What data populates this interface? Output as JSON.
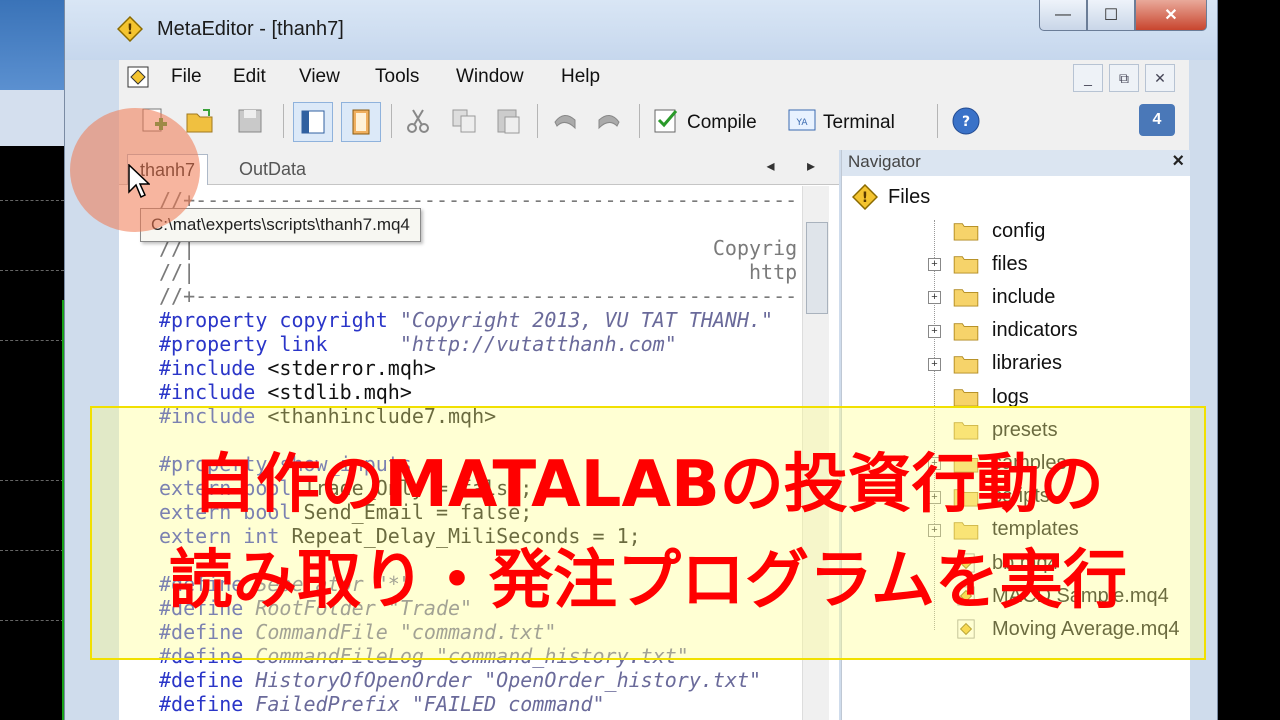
{
  "window": {
    "title": "MetaEditor - [thanh7]",
    "controls": {
      "minimize": "—",
      "maximize": "☐",
      "close": "✕"
    }
  },
  "menu": {
    "items": [
      "File",
      "Edit",
      "View",
      "Tools",
      "Window",
      "Help"
    ],
    "mdi_controls": {
      "minimize": "_",
      "restore": "⧉",
      "close": "✕"
    }
  },
  "toolbar": {
    "compile_label": "Compile",
    "terminal_label": "Terminal",
    "notification_count": "4"
  },
  "editor": {
    "tabs": [
      {
        "label": "thanh7",
        "active": true
      },
      {
        "label": "OutData",
        "active": false
      }
    ],
    "tab_scroll": "◂ ▸",
    "tooltip": "C:\\mat\\experts\\scripts\\thanh7.mq4",
    "code_lines": [
      {
        "kind": "comment",
        "text": "//+-------------------------------------------------------"
      },
      {
        "kind": "comment",
        "text": "//|"
      },
      {
        "kind": "comment",
        "text": "//|                                           Copyright"
      },
      {
        "kind": "comment",
        "text": "//|                                              http://"
      },
      {
        "kind": "comment",
        "text": "//+-------------------------------------------------------"
      },
      {
        "kind": "property",
        "keyword": "#property copyright",
        "value": " \"Copyright 2013, VU TAT THANH.\""
      },
      {
        "kind": "property",
        "keyword": "#property link",
        "value": "      \"http://vutatthanh.com\""
      },
      {
        "kind": "include",
        "keyword": "#include",
        "value": " <stderror.mqh>"
      },
      {
        "kind": "include",
        "keyword": "#include",
        "value": " <stdlib.mqh>"
      },
      {
        "kind": "include",
        "keyword": "#include",
        "value": " <thanhinclude7.mqh>"
      },
      {
        "kind": "blank",
        "text": ""
      },
      {
        "kind": "property",
        "keyword": "#property show_inputs",
        "value": ""
      },
      {
        "kind": "extern",
        "keyword": "extern bool",
        "value": " Trade_Only = false;"
      },
      {
        "kind": "extern",
        "keyword": "extern bool",
        "value": " Send_Email = false;"
      },
      {
        "kind": "extern",
        "keyword": "extern int",
        "value": " Repeat_Delay_MiliSeconds = 1;"
      },
      {
        "kind": "blank",
        "text": ""
      },
      {
        "kind": "define",
        "keyword": "#define",
        "value": " Seperator \"*\""
      },
      {
        "kind": "define",
        "keyword": "#define",
        "value": " RootFolder \"Trade\""
      },
      {
        "kind": "define",
        "keyword": "#define",
        "value": " CommandFile \"command.txt\""
      },
      {
        "kind": "define",
        "keyword": "#define",
        "value": " CommandFileLog \"command_history.txt\""
      },
      {
        "kind": "define",
        "keyword": "#define",
        "value": " HistoryOfOpenOrder \"OpenOrder_history.txt\""
      },
      {
        "kind": "define",
        "keyword": "#define",
        "value": " FailedPrefix \"FAILED command\""
      }
    ]
  },
  "navigator": {
    "title": "Navigator",
    "close": "×",
    "root": "Files",
    "items": [
      {
        "label": "config",
        "type": "folder",
        "expandable": false
      },
      {
        "label": "files",
        "type": "folder",
        "expandable": true
      },
      {
        "label": "include",
        "type": "folder",
        "expandable": true
      },
      {
        "label": "indicators",
        "type": "folder",
        "expandable": true
      },
      {
        "label": "libraries",
        "type": "folder",
        "expandable": true
      },
      {
        "label": "logs",
        "type": "folder",
        "expandable": false
      },
      {
        "label": "presets",
        "type": "folder",
        "expandable": false
      },
      {
        "label": "samples",
        "type": "folder",
        "expandable": true
      },
      {
        "label": "scripts",
        "type": "folder",
        "expandable": true
      },
      {
        "label": "templates",
        "type": "folder",
        "expandable": true
      },
      {
        "label": "bb.mq4",
        "type": "file",
        "expandable": false
      },
      {
        "label": "MACD Sample.mq4",
        "type": "file",
        "expandable": false
      },
      {
        "label": "Moving Average.mq4",
        "type": "file",
        "expandable": false
      }
    ]
  },
  "caption": {
    "line1": "自作のMATALABの投資行動の",
    "line2": "読み取り・発注プログラムを実行"
  },
  "colors": {
    "caption_text": "#ff0000",
    "overlay_border": "#f1e000",
    "code_keyword": "#2a35c8",
    "folder_yellow": "#f6d36a"
  }
}
